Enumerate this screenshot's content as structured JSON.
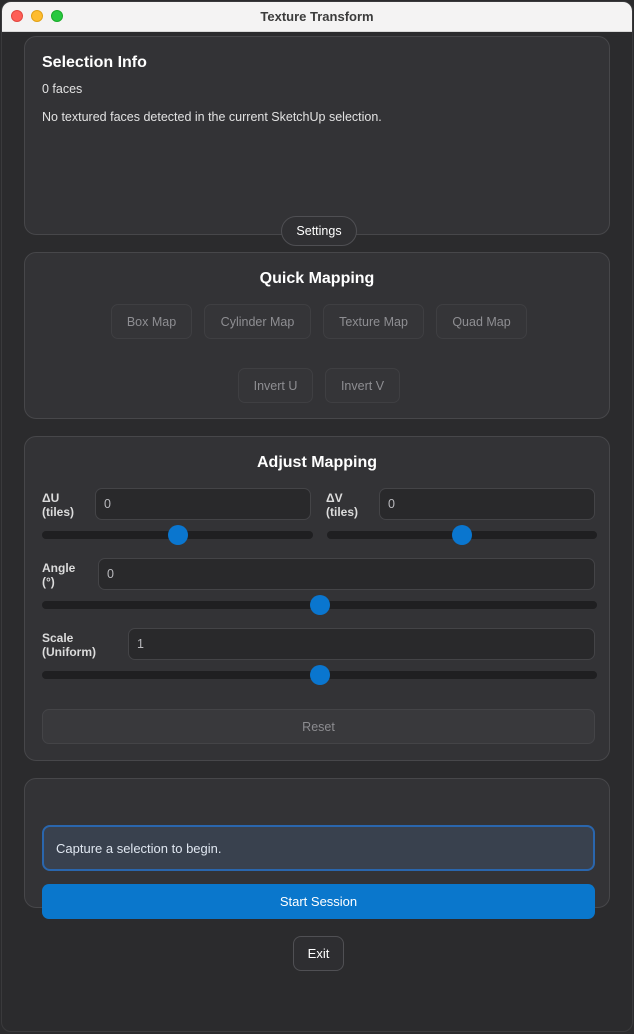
{
  "window": {
    "title": "Texture Transform"
  },
  "selection": {
    "heading": "Selection Info",
    "faces": "0 faces",
    "message": "No textured faces detected in the current SketchUp selection.",
    "settings_label": "Settings"
  },
  "quick": {
    "heading": "Quick Mapping",
    "buttons": [
      "Box Map",
      "Cylinder Map",
      "Texture Map",
      "Quad Map",
      "Invert U",
      "Invert V"
    ]
  },
  "adjust": {
    "heading": "Adjust Mapping",
    "du": {
      "label_top": "ΔU",
      "label_bottom": "(tiles)",
      "value": "0",
      "slider": 0.5
    },
    "dv": {
      "label_top": "ΔV",
      "label_bottom": "(tiles)",
      "value": "0",
      "slider": 0.5
    },
    "angle": {
      "label_top": "Angle",
      "label_bottom": "(°)",
      "value": "0",
      "slider": 0.5
    },
    "scale": {
      "label_top": "Scale",
      "label_bottom": "(Uniform)",
      "value": "1",
      "slider": 0.5
    },
    "reset_label": "Reset"
  },
  "session": {
    "status": "Capture a selection to begin.",
    "start_label": "Start Session"
  },
  "exit_label": "Exit",
  "colors": {
    "accent": "#0a77cc",
    "panel": "#333336",
    "background": "#2b2b2d"
  }
}
